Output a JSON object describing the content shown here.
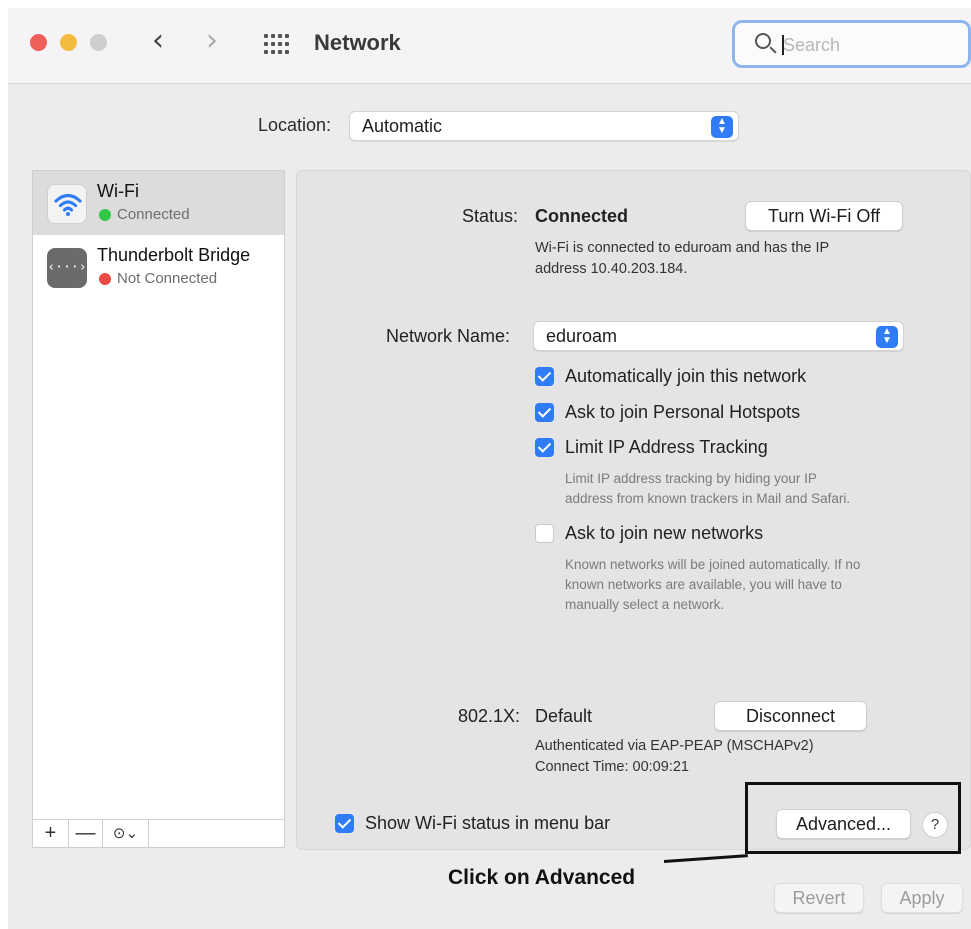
{
  "window": {
    "title": "Network"
  },
  "search": {
    "placeholder": "Search"
  },
  "location": {
    "label": "Location:",
    "value": "Automatic"
  },
  "services": [
    {
      "name": "Wi-Fi",
      "status": "Connected",
      "status_color": "#33c748",
      "icon": "wifi-icon"
    },
    {
      "name": "Thunderbolt Bridge",
      "status": "Not Connected",
      "status_color": "#ec4b41",
      "icon": "thunderbolt-bridge-icon"
    }
  ],
  "sidebar_tools": {
    "add": "+",
    "remove": "—",
    "more": "⊙⌄"
  },
  "detail": {
    "status_label": "Status:",
    "status_value": "Connected",
    "turn_off_button": "Turn Wi-Fi Off",
    "status_desc_1": "Wi-Fi is connected to eduroam and has the IP",
    "status_desc_2": "address 10.40.203.184.",
    "network_name_label": "Network Name:",
    "network_name_value": "eduroam",
    "options": [
      {
        "label": "Automatically join this network",
        "checked": true
      },
      {
        "label": "Ask to join Personal Hotspots",
        "checked": true
      },
      {
        "label": "Limit IP Address Tracking",
        "checked": true
      },
      {
        "label": "Ask to join new networks",
        "checked": false
      }
    ],
    "limit_note_1": "Limit IP address tracking by hiding your IP",
    "limit_note_2": "address from known trackers in Mail and Safari.",
    "new_note_1": "Known networks will be joined automatically. If no",
    "new_note_2": "known networks are available, you will have to",
    "new_note_3": "manually select a network.",
    "dot1x_label": "802.1X:",
    "dot1x_value": "Default",
    "disconnect_button": "Disconnect",
    "auth_line": "Authenticated via EAP-PEAP (MSCHAPv2)",
    "connect_time": "Connect Time: 00:09:21",
    "show_status_label": "Show Wi-Fi status in menu bar",
    "advanced_button": "Advanced...",
    "help": "?"
  },
  "footer": {
    "revert": "Revert",
    "apply": "Apply"
  },
  "annotation": {
    "text": "Click on Advanced"
  },
  "colors": {
    "accent": "#2f7cf6",
    "connected": "#33c748",
    "disconnected": "#ec4b41"
  }
}
